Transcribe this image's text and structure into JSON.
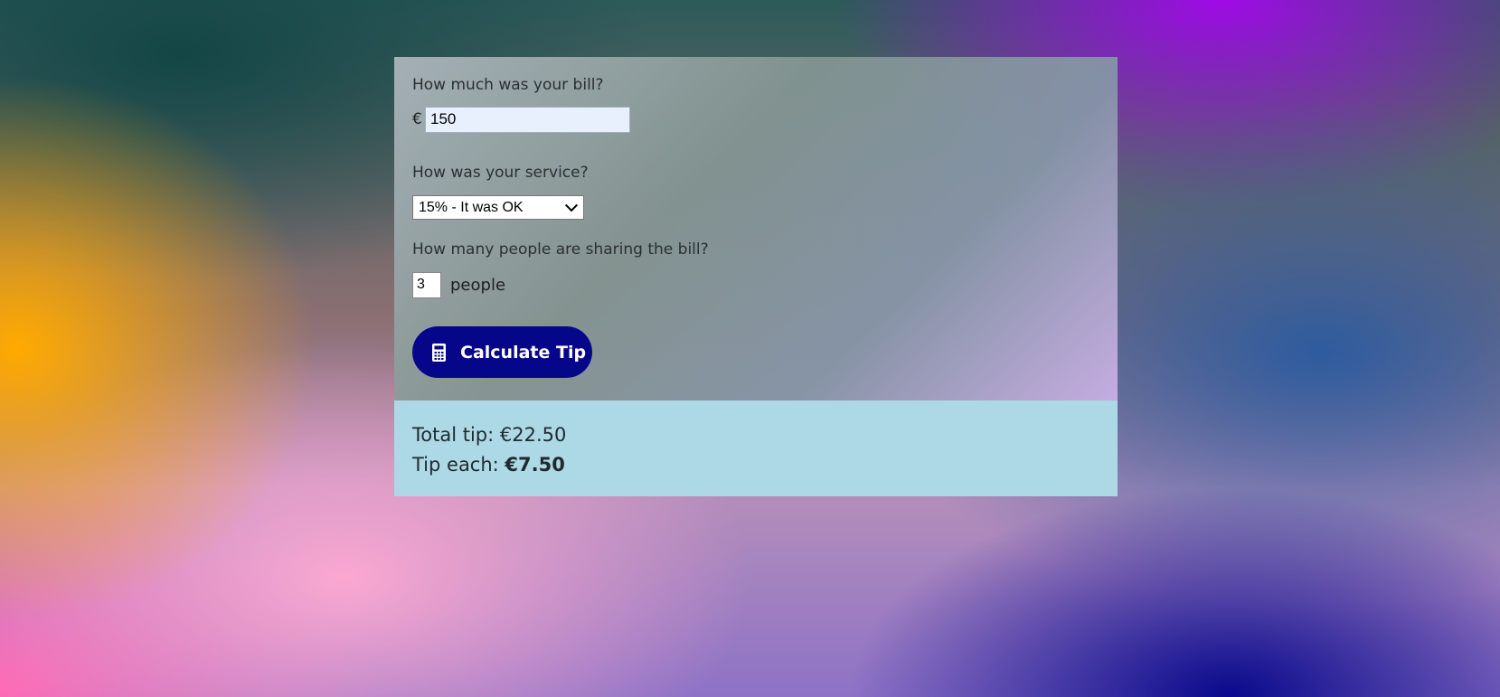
{
  "bill": {
    "question": "How much was your bill?",
    "currency_symbol": "€",
    "amount": "150"
  },
  "service": {
    "question": "How was your service?",
    "selected_option": "15% - It was OK"
  },
  "people": {
    "question": "How many people are sharing the bill?",
    "count": "3",
    "unit_label": "people"
  },
  "calculate_button": {
    "label": "Calculate Tip",
    "icon": "calculator-icon"
  },
  "results": {
    "total_label": "Total tip: ",
    "total_value": "€22.50",
    "each_label": "Tip each: ",
    "each_value": "€7.50"
  },
  "colors": {
    "button_bg": "#06068a",
    "result_bg": "#add8e6"
  }
}
